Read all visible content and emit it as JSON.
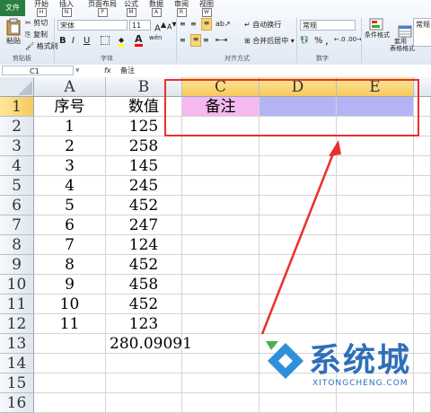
{
  "ribbon": {
    "tabs": [
      {
        "label": "文件"
      },
      {
        "label": "开始",
        "key": "H"
      },
      {
        "label": "插入",
        "key": "N"
      },
      {
        "label": "页面布局",
        "key": "P"
      },
      {
        "label": "公式",
        "key": "M"
      },
      {
        "label": "数据",
        "key": "A"
      },
      {
        "label": "审阅",
        "key": "R"
      },
      {
        "label": "视图",
        "key": "W"
      }
    ],
    "clipboard": {
      "paste": "粘贴",
      "cut": "剪切",
      "copy": "复制",
      "format_painter": "格式刷",
      "group": "剪贴板"
    },
    "font": {
      "name": "宋体",
      "size": "11",
      "bold": "B",
      "italic": "I",
      "underline": "U",
      "grow": "A",
      "shrink": "A",
      "color_a": "A",
      "wen": "wén",
      "group": "字体"
    },
    "alignment": {
      "wrap": "自动换行",
      "merge": "合并后居中",
      "group": "对齐方式"
    },
    "number": {
      "format": "常规",
      "percent": "%",
      "comma": ",",
      "group": "数字"
    },
    "styles": {
      "conditional": "条件格式",
      "table": "套用\n表格格式",
      "cell_style": "常规"
    },
    "colors": {
      "accent": "#2a7d3e",
      "fill": "#ffff00",
      "font_color": "#ff0000"
    }
  },
  "formula_bar": {
    "name_box": "C1",
    "fx": "fx",
    "content": "备注"
  },
  "sheet": {
    "columns": [
      "A",
      "B",
      "C",
      "D",
      "E"
    ],
    "rows": [
      {
        "n": "1",
        "a": "序号",
        "b": "数值",
        "c": "备注"
      },
      {
        "n": "2",
        "a": "1",
        "b": "125"
      },
      {
        "n": "3",
        "a": "2",
        "b": "258"
      },
      {
        "n": "4",
        "a": "3",
        "b": "145"
      },
      {
        "n": "5",
        "a": "4",
        "b": "245"
      },
      {
        "n": "6",
        "a": "5",
        "b": "452"
      },
      {
        "n": "7",
        "a": "6",
        "b": "247"
      },
      {
        "n": "8",
        "a": "7",
        "b": "124"
      },
      {
        "n": "9",
        "a": "8",
        "b": "452"
      },
      {
        "n": "10",
        "a": "9",
        "b": "458"
      },
      {
        "n": "11",
        "a": "10",
        "b": "452"
      },
      {
        "n": "12",
        "a": "11",
        "b": "123"
      },
      {
        "n": "13",
        "a": "",
        "b": "280.09091"
      },
      {
        "n": "14",
        "a": "",
        "b": ""
      },
      {
        "n": "15",
        "a": "",
        "b": ""
      },
      {
        "n": "16",
        "a": "",
        "b": ""
      }
    ],
    "colors": {
      "c1_fill": "#f5b8f0",
      "d1_e1_fill": "#b4b4f4",
      "annotation": "#e8302a"
    }
  },
  "watermark": {
    "brand": "系统城",
    "domain": "XITONGCHENG.COM"
  }
}
